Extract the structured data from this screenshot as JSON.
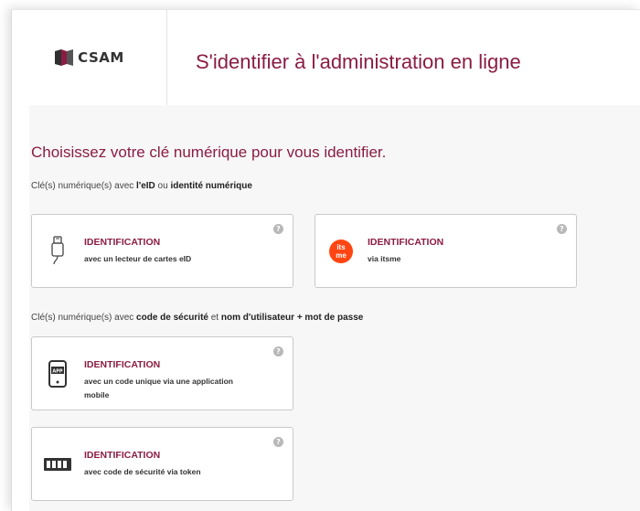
{
  "header": {
    "logo_text": "CSAM",
    "title": "S'identifier à l'administration en ligne"
  },
  "main": {
    "title": "Choisissez votre clé numérique pour vous identifier.",
    "section1": {
      "prefix": "Clé(s) numérique(s) avec ",
      "bold1": "l'eID",
      "middle": " ou ",
      "bold2": "identité numérique"
    },
    "section2": {
      "prefix": "Clé(s) numérique(s) avec ",
      "bold1": "code de sécurité",
      "middle": " et ",
      "bold2": "nom d'utilisateur + mot de passe"
    },
    "cards": [
      {
        "title": "IDENTIFICATION",
        "desc": "avec un lecteur de cartes eID",
        "icon": "card-reader-icon"
      },
      {
        "title": "IDENTIFICATION",
        "desc": "via itsme",
        "icon": "itsme-icon",
        "badge_top": "its",
        "badge_bottom": "me"
      },
      {
        "title": "IDENTIFICATION",
        "desc": "avec un code unique via une application mobile",
        "icon": "mobile-app-icon",
        "app_label": "APP"
      },
      {
        "title": "IDENTIFICATION",
        "desc": "avec code de sécurité via token",
        "icon": "token-icon"
      }
    ],
    "help_symbol": "?"
  },
  "colors": {
    "brand": "#8a1c44",
    "itsme": "#ff4612",
    "content_bg": "#f7f7f7",
    "card_border": "#c9c9c9"
  }
}
